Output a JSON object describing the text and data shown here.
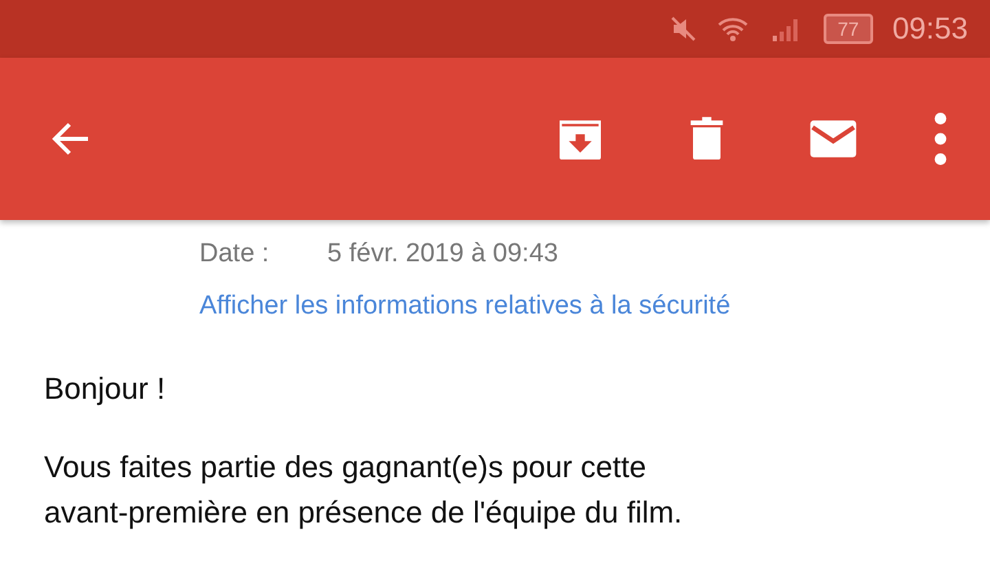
{
  "status_bar": {
    "battery": "77",
    "time": "09:53"
  },
  "toolbar": {
    "actions": [
      {
        "kind": "archive"
      },
      {
        "kind": "delete"
      },
      {
        "kind": "mail"
      },
      {
        "kind": "more"
      }
    ]
  },
  "message": {
    "date_label": "Date :",
    "date_value": "5 févr. 2019 à 09:43",
    "security_link": "Afficher les informations relatives à la sécurité",
    "paragraphs": [
      "Bonjour !",
      "Vous faites partie des gagnant(e)s pour cette avant-première en présence de l'équipe du film."
    ]
  }
}
